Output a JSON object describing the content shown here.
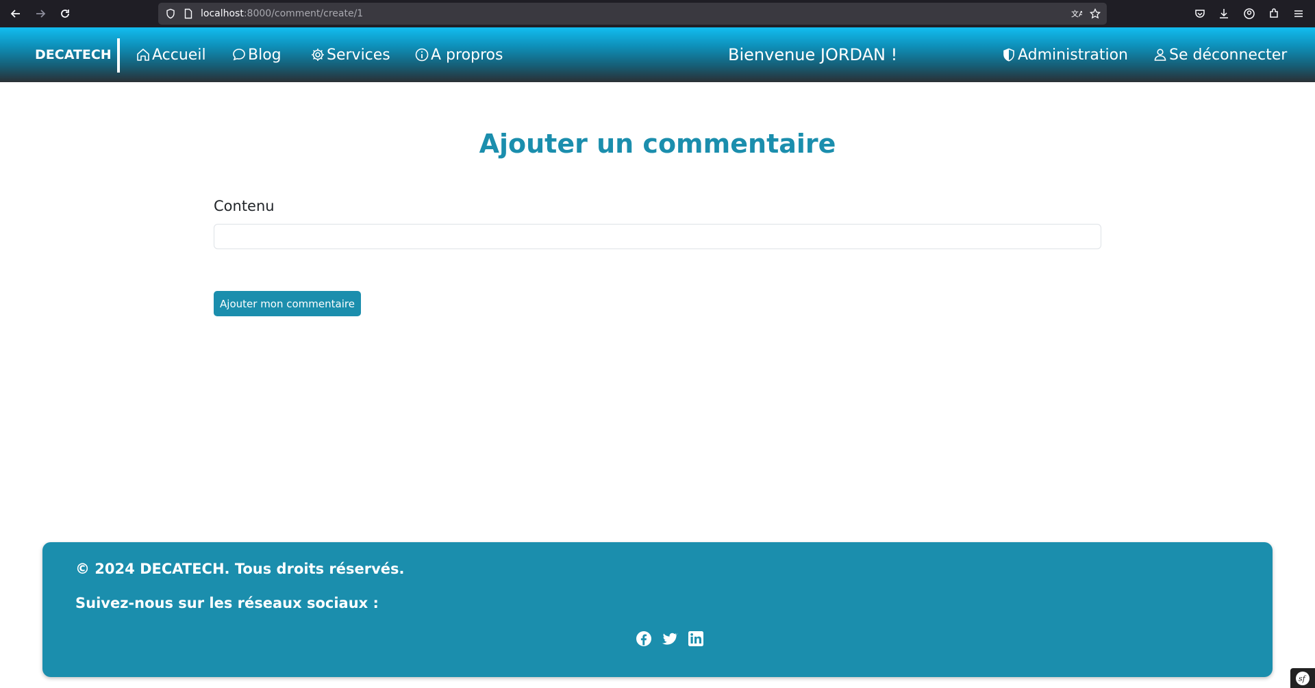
{
  "browser": {
    "url_host": "localhost",
    "url_rest": ":8000/comment/create/1"
  },
  "navbar": {
    "brand": "DECATECH",
    "items": [
      {
        "label": "Accueil",
        "icon": "house-icon"
      },
      {
        "label": "Blog",
        "icon": "chat-bubble-icon"
      },
      {
        "label": "Services",
        "icon": "gear-icon"
      },
      {
        "label": "A propros",
        "icon": "info-circle-icon"
      }
    ],
    "welcome": "Bienvenue JORDAN !",
    "admin_label": "Administration",
    "logout_label": "Se déconnecter"
  },
  "main": {
    "title": "Ajouter un commentaire",
    "content_label": "Contenu",
    "content_value": "",
    "submit_label": "Ajouter mon commentaire"
  },
  "footer": {
    "copyright": "© 2024 DECATECH. Tous droits réservés.",
    "follow_text": "Suivez-nous sur les réseaux sociaux :",
    "social": [
      "facebook-icon",
      "twitter-icon",
      "linkedin-icon"
    ]
  },
  "colors": {
    "accent": "#1b8ead",
    "nav_gradient_top": "#12bdf0",
    "nav_gradient_bottom": "#2a3035",
    "browser_bg": "#1f1e25"
  }
}
